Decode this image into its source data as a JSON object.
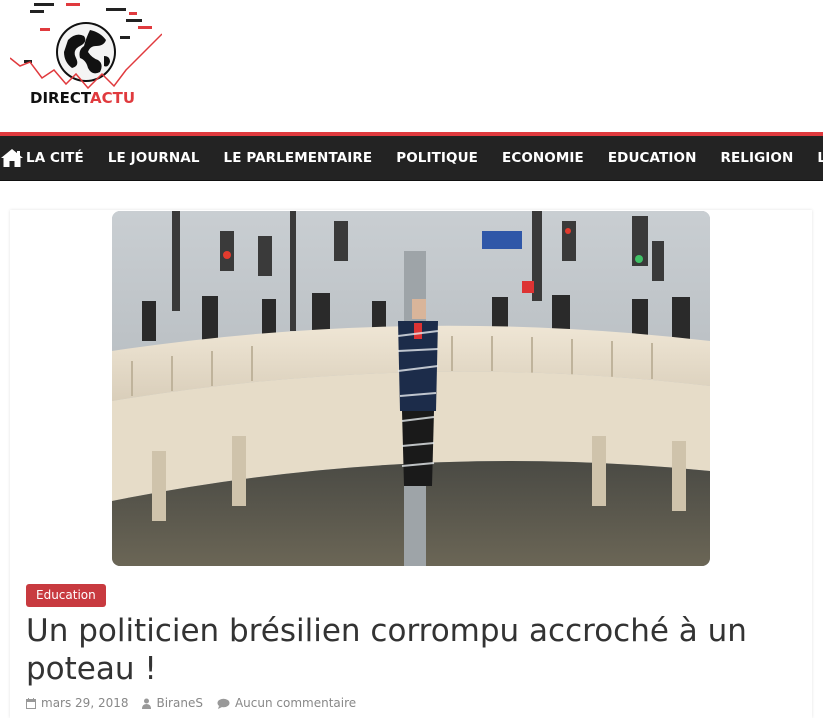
{
  "site": {
    "logo_text_1": "DIRECT",
    "logo_text_2": "ACTU"
  },
  "nav": {
    "home_icon": "home-icon",
    "items": [
      {
        "label": "LA CITÉ"
      },
      {
        "label": "LE JOURNAL"
      },
      {
        "label": "LE PARLEMENTAIRE"
      },
      {
        "label": "POLITIQUE"
      },
      {
        "label": "ECONOMIE"
      },
      {
        "label": "EDUCATION"
      },
      {
        "label": "RELIGION"
      },
      {
        "label": "LE P"
      }
    ]
  },
  "article": {
    "category": "Education",
    "title": "Un politicien brésilien corrompu accroché à un poteau !",
    "date": "mars 29, 2018",
    "author": "BiraneS",
    "comments": "Aucun commentaire"
  },
  "colors": {
    "accent": "#c83a3f",
    "nav_bg": "#232323",
    "title": "#333333",
    "meta": "#888888"
  }
}
